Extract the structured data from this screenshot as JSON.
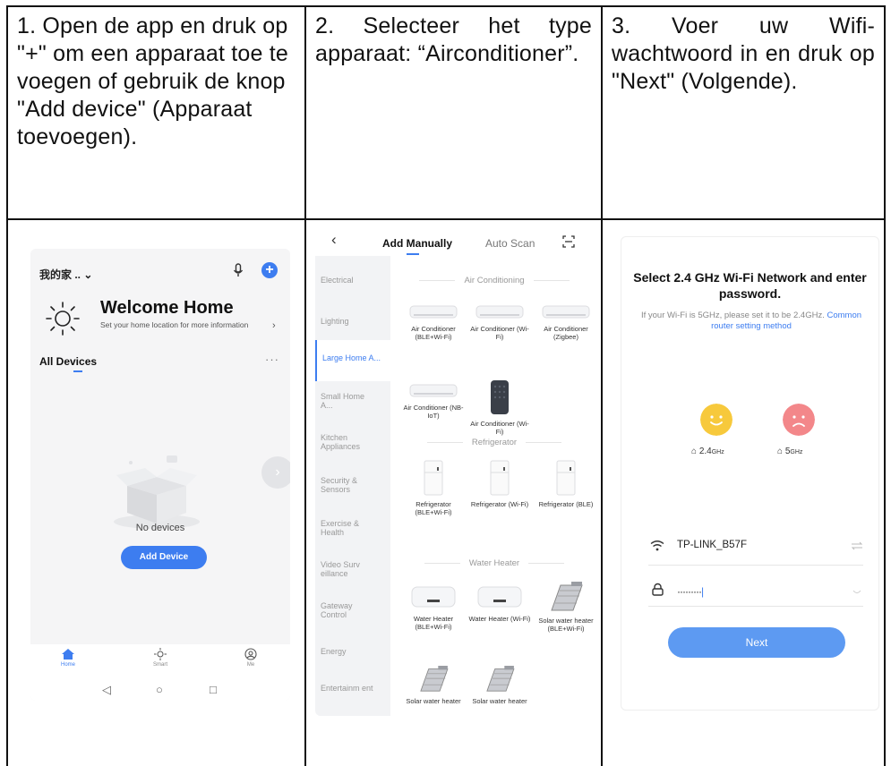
{
  "steps": [
    {
      "instruction": "1. Open de app en druk op \"+\" om een apparaat toe te voegen of gebruik de knop \"Add device\" (Apparaat toevoegen).",
      "screen": {
        "home_label": "我的家 .. ⌄",
        "welcome_title": "Welcome Home",
        "welcome_sub": "Set your home location for more information",
        "all_devices": "All Devices",
        "more": "···",
        "empty_text": "No devices",
        "add_button": "Add Device",
        "tabs": [
          "Home",
          "Smart",
          "Me"
        ]
      }
    },
    {
      "instruction": "2. Selecteer het type apparaat: “Airconditioner”.",
      "screen": {
        "tab_manual": "Add Manually",
        "tab_auto": "Auto Scan",
        "categories": [
          "Electrical",
          "Lighting",
          "Large Home A...",
          "Small Home A...",
          "Kitchen Appliances",
          "Security & Sensors",
          "Exercise & Health",
          "Video Surv eillance",
          "Gateway Control",
          "Energy",
          "Entertainm ent"
        ],
        "section_ac": "Air Conditioning",
        "ac_items": [
          "Air Conditioner (BLE+Wi-Fi)",
          "Air Conditioner (Wi-Fi)",
          "Air Conditioner (Zigbee)",
          "Air Conditioner (NB-IoT)",
          "Air Conditioner (Wi-Fi)"
        ],
        "section_fridge": "Refrigerator",
        "fridge_items": [
          "Refrigerator (BLE+Wi-Fi)",
          "Refrigerator (Wi-Fi)",
          "Refrigerator (BLE)"
        ],
        "section_heater": "Water Heater",
        "heater_items": [
          "Water Heater (BLE+Wi-Fi)",
          "Water Heater (Wi-Fi)",
          "Solar water heater (BLE+Wi-Fi)",
          "Solar water heater",
          "Solar water heater"
        ]
      }
    },
    {
      "instruction": "3. Voer uw Wifi-wachtwoord in en druk op \"Next\" (Volgende).",
      "screen": {
        "heading": "Select 2.4 GHz Wi-Fi Network and enter password.",
        "sub_text": "If your Wi-Fi is 5GHz, please set it to be 2.4GHz.",
        "sub_link": "Common router setting method",
        "band_24": "2.4",
        "band_5": "5",
        "band_unit": "GHz",
        "ssid": "TP-LINK_B57F",
        "password_mask": "·········",
        "next_button": "Next"
      }
    }
  ],
  "colors": {
    "accent": "#3d7df0",
    "next_button": "#5d9af2",
    "happy_face": "#f7c93c",
    "sad_face": "#f3878a"
  }
}
